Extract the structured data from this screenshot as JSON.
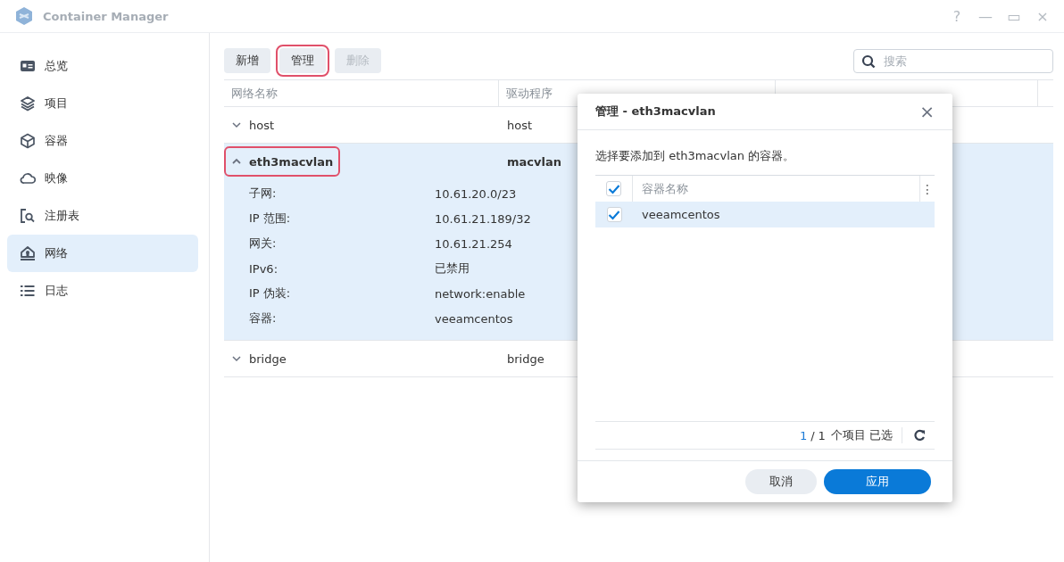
{
  "window": {
    "title": "Container Manager",
    "controls": [
      "?",
      "—",
      "▭",
      "×"
    ]
  },
  "sidebar": {
    "items": [
      {
        "label": "总览",
        "selected": false
      },
      {
        "label": "项目",
        "selected": false
      },
      {
        "label": "容器",
        "selected": false
      },
      {
        "label": "映像",
        "selected": false
      },
      {
        "label": "注册表",
        "selected": false
      },
      {
        "label": "网络",
        "selected": true
      },
      {
        "label": "日志",
        "selected": false
      }
    ]
  },
  "toolbar": {
    "buttons": [
      {
        "label": "新增",
        "disabled": false,
        "highlighted": false
      },
      {
        "label": "管理",
        "disabled": false,
        "highlighted": true
      },
      {
        "label": "删除",
        "disabled": true,
        "highlighted": false
      }
    ],
    "search": {
      "placeholder": "搜索"
    }
  },
  "table": {
    "columns": [
      "网络名称",
      "驱动程序"
    ],
    "rows": [
      {
        "name": "host",
        "driver": "host",
        "expanded": false,
        "selected": false,
        "highlighted": false
      },
      {
        "name": "eth3macvlan",
        "driver": "macvlan",
        "expanded": true,
        "selected": true,
        "highlighted": true,
        "details": [
          {
            "label": "子网:",
            "value": "10.61.20.0/23"
          },
          {
            "label": "IP 范围:",
            "value": "10.61.21.189/32"
          },
          {
            "label": "网关:",
            "value": "10.61.21.254"
          },
          {
            "label": "IPv6:",
            "value": "已禁用"
          },
          {
            "label": "IP 伪装:",
            "value": "network:enable"
          },
          {
            "label": "容器:",
            "value": "veeamcentos"
          }
        ]
      },
      {
        "name": "bridge",
        "driver": "bridge",
        "expanded": false,
        "selected": false,
        "highlighted": false
      }
    ]
  },
  "dialog": {
    "title": "管理 - eth3macvlan",
    "close": "×",
    "message": "选择要添加到 eth3macvlan 的容器。",
    "header": {
      "label": "容器名称",
      "checked": true,
      "menu": "⋮"
    },
    "rows": [
      {
        "name": "veeamcentos",
        "checked": true,
        "selected": true
      }
    ],
    "footer": {
      "selected_count": "1",
      "separator": "/",
      "total": "1",
      "suffix": "个项目 已选"
    },
    "buttons": [
      {
        "label": "取消",
        "kind": "secondary"
      },
      {
        "label": "应用",
        "kind": "primary"
      }
    ]
  }
}
